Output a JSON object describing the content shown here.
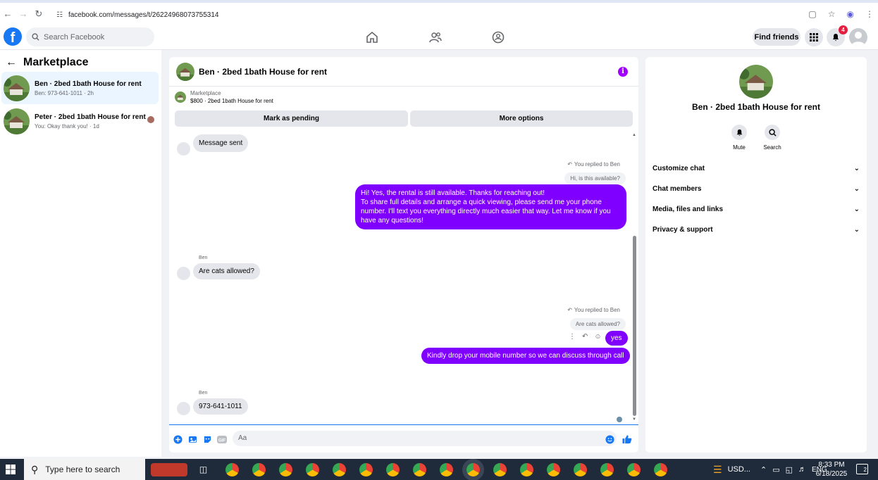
{
  "browser": {
    "url": "facebook.com/messages/t/26224968073755314"
  },
  "fb": {
    "search_placeholder": "Search Facebook",
    "find_friends": "Find friends",
    "notification_count": "4"
  },
  "sidebar": {
    "title": "Marketplace",
    "conversations": [
      {
        "title": "Ben · 2bed 1bath House for rent",
        "subtitle": "Ben: 973-641-1011 · 2h"
      },
      {
        "title": "Peter · 2bed 1bath House for rent",
        "subtitle": "You: Okay thank you! · 1d"
      }
    ]
  },
  "chat": {
    "header_title": "Ben · 2bed 1bath House for rent",
    "marketplace_label": "Marketplace",
    "listing": "$800 · 2bed 1bath House for rent",
    "mark_pending": "Mark as pending",
    "more_options": "More options",
    "messages": {
      "m1": "Message sent",
      "reply_note_1": "You replied to Ben",
      "quote_1": "Hi, is this available?",
      "out_1": "Hi! Yes, the rental is still available. Thanks for reaching out!\nTo share full details and arrange a quick viewing, please send me your phone number. I'll text you everything directly much easier that way. Let me know if you have any questions!",
      "sender_1": "Ben",
      "in_2": "Are cats allowed?",
      "reply_note_2": "You replied to Ben",
      "quote_2": "Are cats allowed?",
      "out_2": "yes",
      "out_3": "Kindly drop your mobile number so we can discuss through call",
      "sender_2": "Ben",
      "in_3": "973-641-1011"
    },
    "composer_placeholder": "Aa"
  },
  "info": {
    "name": "Ben · 2bed 1bath House for rent",
    "mute": "Mute",
    "search": "Search",
    "sections": [
      "Customize chat",
      "Chat members",
      "Media, files and links",
      "Privacy & support"
    ]
  },
  "taskbar": {
    "search_placeholder": "Type here to search",
    "weather": "USD...",
    "language": "ENG",
    "time": "8:33 PM",
    "date": "6/18/2025",
    "notifications": "2"
  },
  "colors": {
    "accent": "#8000ff",
    "fb_blue": "#1877f2",
    "badge": "#e41e3f"
  }
}
